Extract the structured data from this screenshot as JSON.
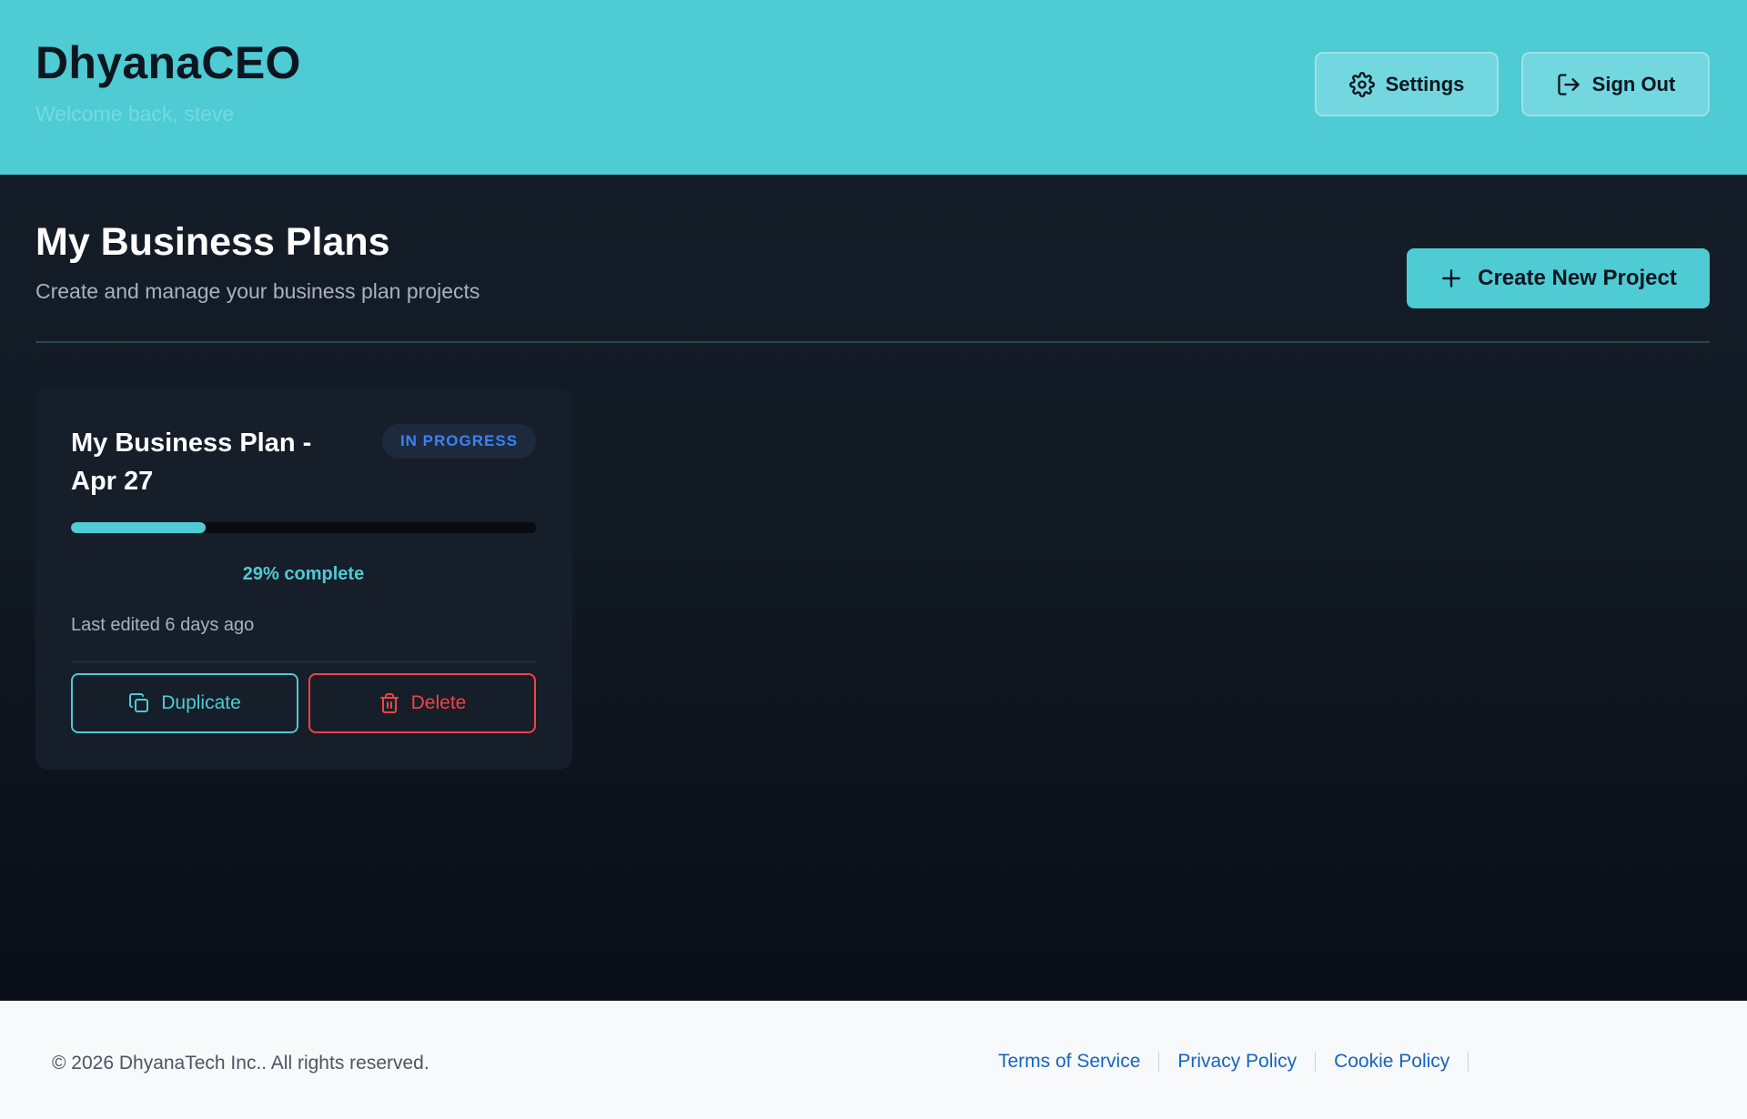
{
  "header": {
    "brand": "DhyanaCEO",
    "welcome": "Welcome back, steve",
    "settings_label": "Settings",
    "signout_label": "Sign Out"
  },
  "main": {
    "title": "My Business Plans",
    "subtitle": "Create and manage your business plan projects",
    "create_label": "Create New Project"
  },
  "project": {
    "title": "My Business Plan - Apr 27",
    "status": "IN PROGRESS",
    "progress_percent": 29,
    "progress_text": "29% complete",
    "last_edited": "Last edited 6 days ago",
    "duplicate_label": "Duplicate",
    "delete_label": "Delete"
  },
  "footer": {
    "copyright": "© 2026 DhyanaTech Inc.. All rights reserved.",
    "links": [
      "Terms of Service",
      "Privacy Policy",
      "Cookie Policy"
    ]
  },
  "icons": {
    "settings": "gear-icon",
    "signout": "sign-out-icon",
    "create": "plus-icon",
    "duplicate": "copy-icon",
    "delete": "trash-icon"
  },
  "colors": {
    "accent": "#4ecbd3",
    "badge_text": "#3b82f6",
    "danger": "#ef4444",
    "link": "#1565c0"
  }
}
